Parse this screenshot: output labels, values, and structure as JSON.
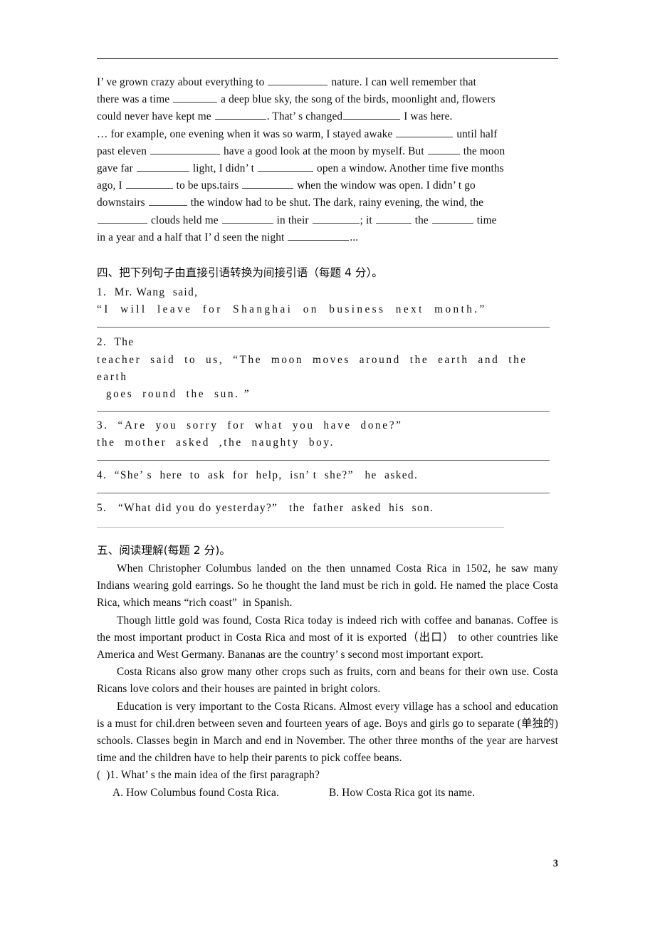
{
  "page": {
    "number": "3",
    "has_header_rule": true
  },
  "cloze_paragraph": {
    "lines": [
      {
        "pre": "I’ ve grown crazy about everything to ",
        "blank": 84,
        "post": " nature. I can well remember that"
      },
      {
        "pre": "there was a time ",
        "blank": 62,
        "post": " a deep blue sky, the song of the birds, moonlight and, flowers"
      },
      {
        "pre": "could never have kept me ",
        "blank": 72,
        "post": ". That’ s changed",
        "blank2": 80,
        "post2": " I was here."
      },
      {
        "pre": "… for example, one evening when it was so warm, I stayed awake ",
        "blank": 80,
        "post": " until half"
      },
      {
        "pre": "past eleven ",
        "blank": 98,
        "post": " have a good look at the moon by myself. But ",
        "blank2": 45,
        "post2": " the moon"
      },
      {
        "pre": "gave far ",
        "blank": 74,
        "post": " light, I didn’ t ",
        "blank2": 78,
        "post2": " open a window. Another time five months"
      },
      {
        "pre": "ago, I ",
        "blank": 66,
        "post": " to be ups.tairs ",
        "blank2": 72,
        "post2": " when the window was open. I didn’ t go"
      },
      {
        "pre": "downstairs ",
        "blank": 54,
        "post": " the window had to be shut. The dark, rainy evening, the wind, the"
      },
      {
        "pre": "",
        "blank": 70,
        "post": " clouds held me ",
        "blank2": 72,
        "post2": " in their ",
        "blank3": 66,
        "post3": "; it ",
        "blank4": 50,
        "post4": " the ",
        "blank5": 58,
        "post5": " time"
      },
      {
        "pre": "in a year and a half that I’ d seen the night ",
        "blank": 86,
        "post": "..."
      }
    ]
  },
  "section_four": {
    "heading": "四、把下列句子由直接引语转换为间接引语（每题 4 分）。",
    "items": [
      {
        "num": "1.",
        "line1": "1.  Mr. Wang  said,",
        "line2": "“I  will  leave  for  Shanghai  on  business  next  month.”"
      },
      {
        "num": "2.",
        "line1": "2.  The",
        "line2": "teacher  said  to  us,  “The  moon  moves  around  the  earth  and  the  earth",
        "line3": "  goes  round  the  sun. ”"
      },
      {
        "num": "3.",
        "line1": "3.  “Are  you  sorry  for  what  you  have  done?”",
        "line2": "the  mother  asked  ,the  naughty  boy."
      },
      {
        "num": "4.",
        "line1": "4.  “She’ s  here  to  ask  for  help,  isn’ t  she?”   he  asked."
      },
      {
        "num": "5.",
        "line1": "5.   “What did you do yesterday?”   the  father  asked  his  son."
      }
    ]
  },
  "section_five": {
    "heading": "五、阅读理解(每题 2 分)。",
    "paragraphs": [
      "When Christopher Columbus landed on the then unnamed Costa Rica in 1502, he saw many Indians wearing gold earrings. So he thought the land must be rich in gold. He named the place Costa Rica, which means “rich coast”  in Spanish.",
      "Though little gold was found, Costa Rica today is indeed rich with coffee and bananas. Coffee is the most important product in Costa Rica and most of it is exported（出口） to other countries like America and West Germany. Bananas are the country’ s second most important export.",
      "Costa Ricans also grow many other crops such as fruits, corn and beans for their own use. Costa Ricans love colors and their houses are painted in bright colors.",
      "Education is very important to the Costa Ricans. Almost every village has a school and education is a must for chil.dren between seven and fourteen years of age. Boys and girls go to separate (单独的) schools. Classes begin in March and end in November. The other three months of the year are harvest time and the children have to help their parents to pick coffee beans."
    ],
    "question": {
      "stem": "(  )1. What’ s the main idea of the first paragraph?",
      "option_a": "A. How Columbus found Costa Rica.",
      "option_b": "B. How Costa Rica got its name."
    }
  }
}
